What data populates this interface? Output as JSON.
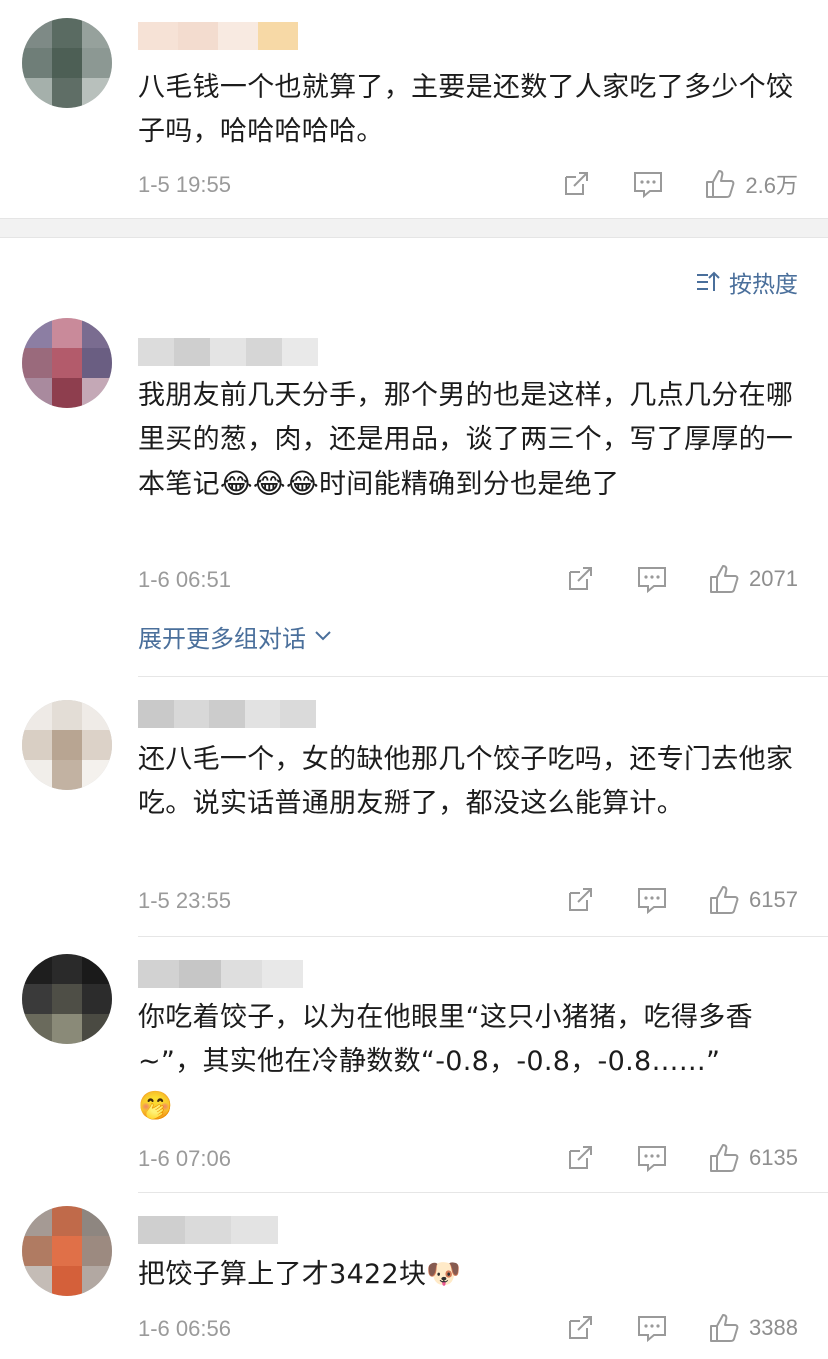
{
  "header": {
    "sort_label": "按热度"
  },
  "thread": {
    "expand_label": "展开更多组对话"
  },
  "comments": [
    {
      "text": "八毛钱一个也就算了，主要是还数了人家吃了多少个饺子吗，哈哈哈哈哈。",
      "time": "1-5 19:55",
      "likes": "2.6万",
      "emoji": []
    },
    {
      "text_parts": [
        "我朋友前几天分手，那个男的也是这样，几点几分在哪里买的葱，肉，还是用品，谈了两三个，写了厚厚的一本笔记",
        "😂😂😂",
        "时间能精确到分也是绝了"
      ],
      "time": "1-6 06:51",
      "likes": "2071"
    },
    {
      "text": "还八毛一个，女的缺他那几个饺子吃吗，还专门去他家吃。说实话普通朋友掰了，都没这么能算计。",
      "time": "1-5 23:55",
      "likes": "6157"
    },
    {
      "text_parts": [
        "你吃着饺子，以为在他眼里“这只小猪猪，吃得多香~”，其实他在冷静数数“-0.8，-0.8，-0.8……”\n",
        "🤭"
      ],
      "time": "1-6 07:06",
      "likes": "6135"
    },
    {
      "text_parts": [
        "把饺子算上了才3422块",
        "🐶"
      ],
      "time": "1-6 06:56",
      "likes": "3388"
    }
  ],
  "colors": {
    "link": "#4a6f9b",
    "meta": "#9a9a9a",
    "icon": "#9a9a9a"
  },
  "icons": {
    "share": "share-icon",
    "reply": "reply-icon",
    "like": "thumbs-up-icon",
    "sort": "sort-icon",
    "expand": "chevron-down-icon"
  }
}
